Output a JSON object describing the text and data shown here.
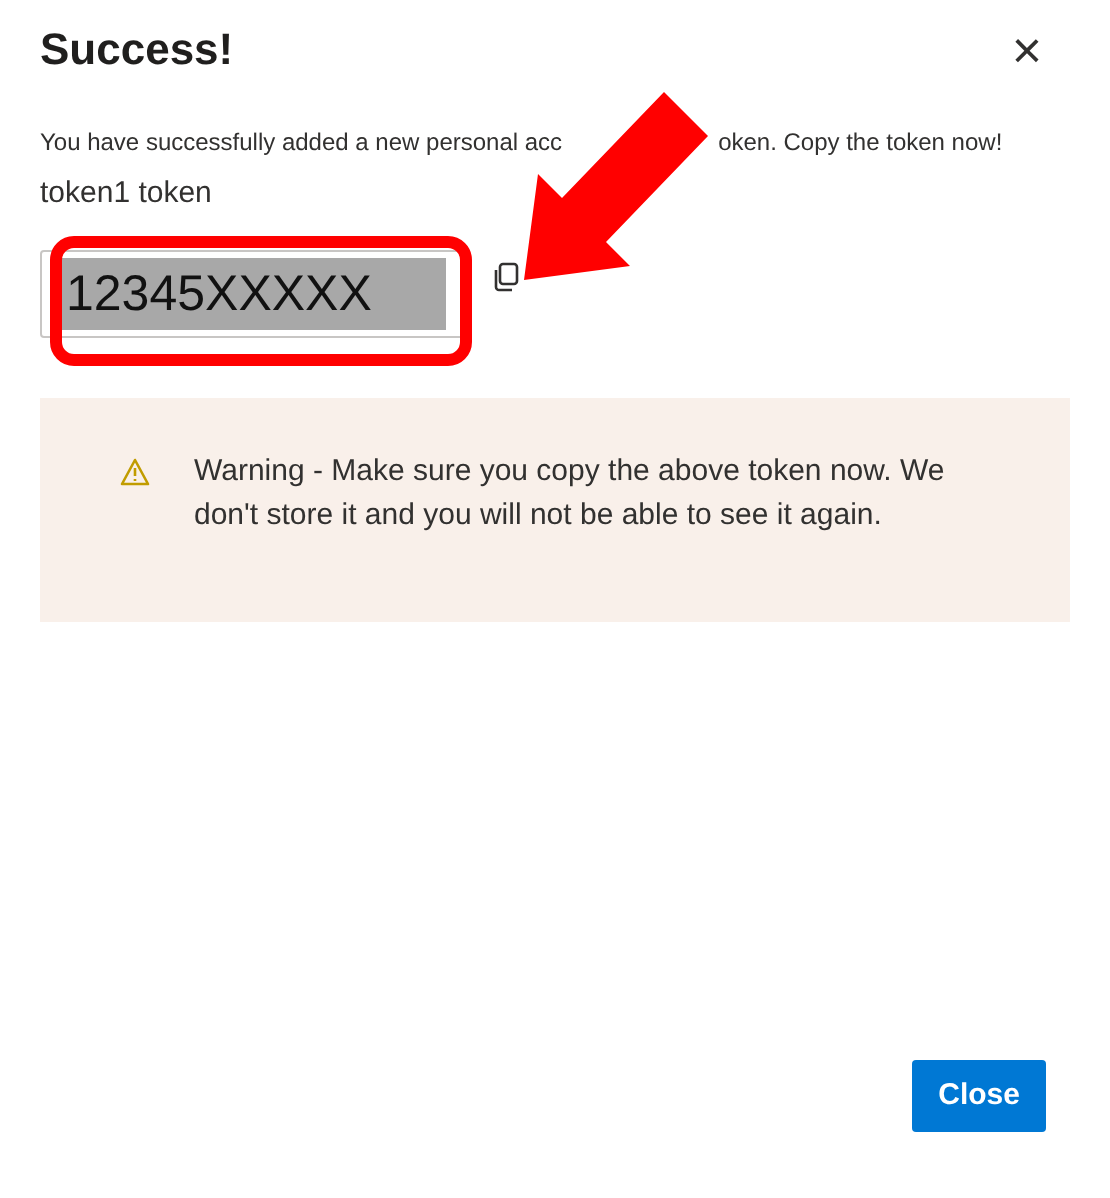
{
  "dialog": {
    "title": "Success!",
    "close_glyph": "×"
  },
  "message_parts": [
    "You have successfully added a new personal acc",
    "oken. Copy the token now!"
  ],
  "token": {
    "label": "token1 token",
    "value": "12345XXXXX"
  },
  "warning": {
    "text": "Warning - Make sure you copy the above token now. We don't store it and you will not be able to see it again."
  },
  "buttons": [
    {
      "label": "Close",
      "kind": "primary"
    }
  ]
}
